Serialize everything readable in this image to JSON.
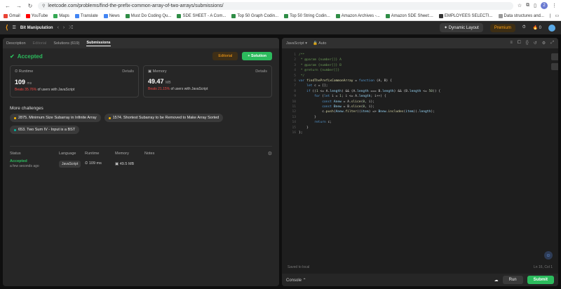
{
  "browser": {
    "url": "leetcode.com/problems/find-the-prefix-common-array-of-two-arrays/submissions/",
    "avatar_letter": "2"
  },
  "bookmarks": [
    {
      "label": "Gmail",
      "color": "#ea4335"
    },
    {
      "label": "YouTube",
      "color": "#ff0000"
    },
    {
      "label": "Maps",
      "color": "#34a853"
    },
    {
      "label": "Translate",
      "color": "#4285f4"
    },
    {
      "label": "News",
      "color": "#4285f4"
    },
    {
      "label": "Must Do Coding Qu...",
      "color": "#2f8d46"
    },
    {
      "label": "SDE SHEET - A Com...",
      "color": "#2f8d46"
    },
    {
      "label": "Top 50 Graph Codin...",
      "color": "#2f8d46"
    },
    {
      "label": "Top 50 String Codin...",
      "color": "#2f8d46"
    },
    {
      "label": "Amazon Archives -...",
      "color": "#2f8d46"
    },
    {
      "label": "Amazon SDE Sheet:...",
      "color": "#2f8d46"
    },
    {
      "label": "EMPLOYEES SELECTI...",
      "color": "#333333"
    },
    {
      "label": "Data structures and...",
      "color": "#999999"
    }
  ],
  "all_bookmarks": "All Bookmarks",
  "header": {
    "title": "Bit Manipulation",
    "dynamic_layout": "Dynamic Layout",
    "premium": "Premium",
    "count": "0"
  },
  "tabs": [
    "Description",
    "Editorial",
    "Solutions (619)",
    "Submissions"
  ],
  "result": {
    "status": "Accepted",
    "editorial_btn": "Editorial",
    "solution_btn": "+ Solution"
  },
  "runtime": {
    "label": "Runtime",
    "details": "Details",
    "value": "109",
    "unit": "ms",
    "beats_pct": "Beats 35.76%",
    "beats_rest": "of users with JavaScript"
  },
  "memory": {
    "label": "Memory",
    "details": "Details",
    "value": "49.47",
    "unit": "MB",
    "beats_pct": "Beats 21.15%",
    "beats_rest": "of users with JavaScript"
  },
  "more_challenges": {
    "title": "More challenges",
    "items": [
      {
        "label": "2875. Minimum Size Subarray in Infinite Array",
        "color": "#ffb800"
      },
      {
        "label": "1574. Shortest Subarray to be Removed to Make Array Sorted",
        "color": "#ffb800"
      },
      {
        "label": "653. Two Sum IV - Input is a BST",
        "color": "#00b8a3"
      }
    ]
  },
  "table": {
    "headers": [
      "Status",
      "Language",
      "Runtime",
      "Memory",
      "Notes"
    ],
    "row": {
      "status": "Accepted",
      "time": "a few seconds ago",
      "language": "JavaScript",
      "runtime": "109 ms",
      "memory": "49.5 MB"
    }
  },
  "editor": {
    "language": "JavaScript",
    "mode": "Auto",
    "saved": "Saved to local",
    "cursor": "Ln 16, Col 1"
  },
  "code_lines": [
    "/**",
    " * @param {number[]} A",
    " * @param {number[]} B",
    " * @return {number[]}",
    " */",
    "var findThePrefixCommonArray = function (A, B) {",
    "    let c = [];",
    "    if ((1 <= A.length) && (A.length === B.length) && (B.length <= 50)) {",
    "        for (let i = 1; i <= A.length; i++) {",
    "            const Anew = A.slice(0, i);",
    "            const Bnew = B.slice(0, i);",
    "            c.push(Anew.filter((item) => Bnew.includes(item)).length);",
    "        }",
    "        return c;",
    "    }",
    "};"
  ],
  "console": {
    "label": "Console",
    "run": "Run",
    "submit": "Submit"
  }
}
